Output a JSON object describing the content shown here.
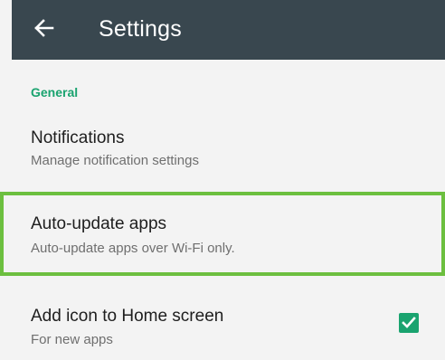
{
  "app_bar": {
    "back_icon": "arrow-left-icon",
    "title": "Settings",
    "background": "#39474f"
  },
  "section": {
    "header": "General",
    "header_color": "#1aa36f"
  },
  "items": [
    {
      "title": "Notifications",
      "subtitle": "Manage notification settings"
    },
    {
      "title": "Auto-update apps",
      "subtitle": "Auto-update apps over Wi-Fi only.",
      "highlighted": true,
      "highlight_color": "#6cbf3f"
    },
    {
      "title": "Add icon to Home screen",
      "subtitle": "For new apps",
      "checkbox": {
        "checked": true,
        "icon": "check-icon",
        "color": "#1aa36f"
      }
    }
  ]
}
